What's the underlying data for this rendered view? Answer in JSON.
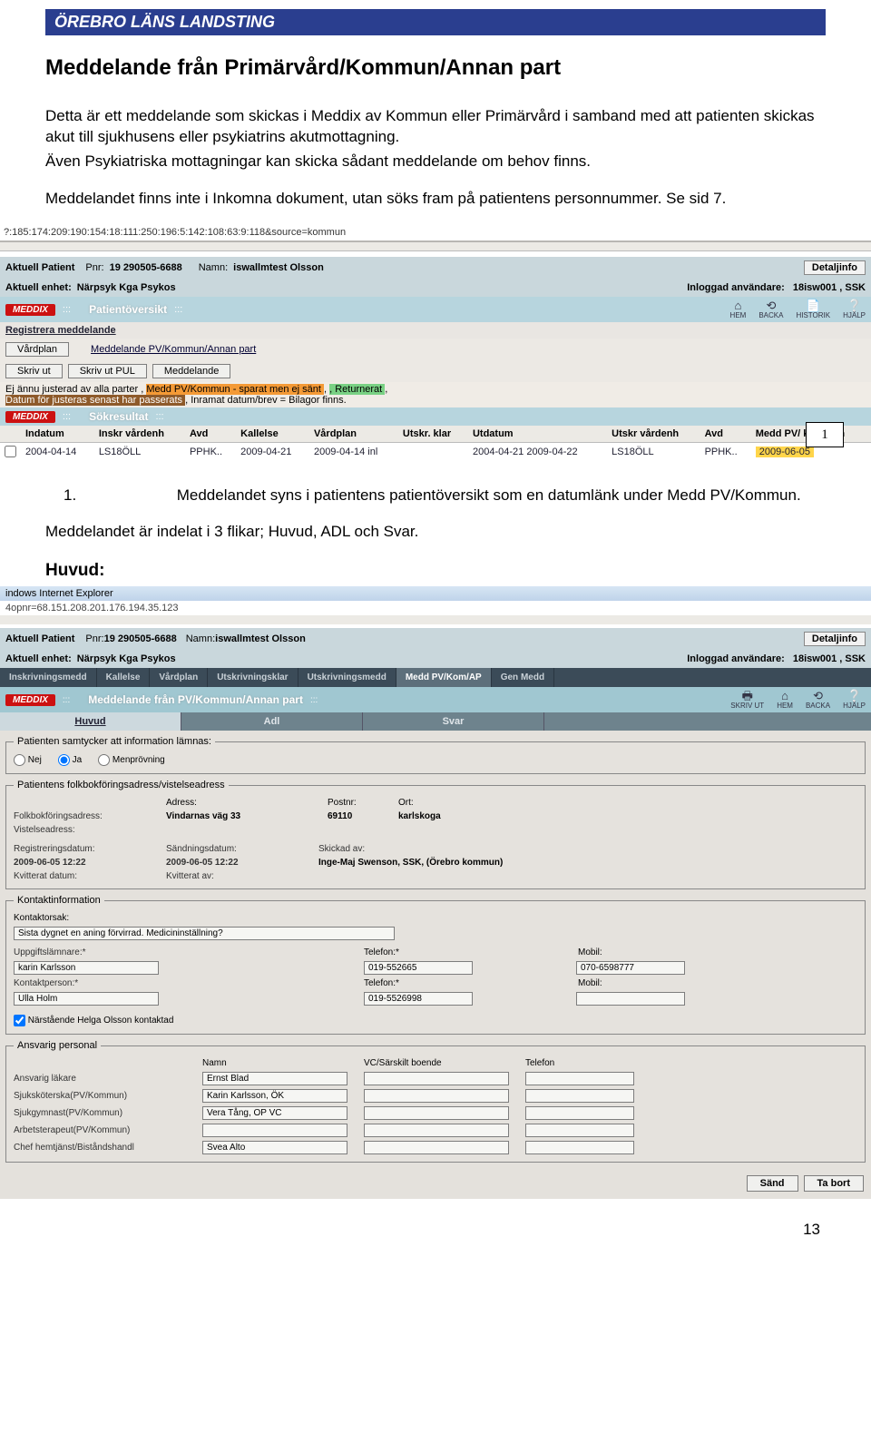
{
  "banner": "ÖREBRO LÄNS LANDSTING",
  "doc": {
    "title": "Meddelande från Primärvård/Kommun/Annan part",
    "para1": "Detta är ett meddelande som skickas i Meddix av Kommun eller Primärvård i samband med att patienten skickas akut till sjukhusens eller psykiatrins akutmottagning.",
    "para2": "Även Psykiatriska mottagningar kan skicka sådant meddelande om behov finns.",
    "para3": "Meddelandet finns inte i Inkomna dokument, utan söks fram på patientens personnummer. Se sid 7.",
    "list_num": "1.",
    "list_text": "Meddelandet syns i patientens patientöversikt som en datumlänk under Medd PV/Kommun.",
    "tabs_text": "Meddelandet är indelat i 3 flikar; Huvud, ADL och Svar.",
    "huvud_head": "Huvud:"
  },
  "shot1": {
    "url": "?:185:174:209:190:154:18:111:250:196:5:142:108:63:9:118&source=kommun",
    "patient_lbl": "Aktuell Patient",
    "pnr_lbl": "Pnr:",
    "pnr": "19 290505-6688",
    "namn_lbl": "Namn:",
    "namn": "iswallmtest Olsson",
    "detail": "Detaljinfo",
    "enhet_lbl": "Aktuell enhet:",
    "enhet": "Närpsyk Kga Psykos",
    "inlogg_lbl": "Inloggad användare:",
    "inlogg": "18isw001 , SSK",
    "overview": "Patientöversikt",
    "icons": {
      "hem": "HEM",
      "backa": "BACKA",
      "historik": "HISTORIK",
      "hjalp": "HJÄLP"
    },
    "reg_medd": "Registrera meddelande",
    "btns1": {
      "vardplan": "Vårdplan",
      "link_mpv": "Meddelande PV/Kommun/Annan part"
    },
    "btns2": {
      "skriv": "Skriv ut",
      "skriv_pul": "Skriv ut PUL",
      "medd": "Meddelande"
    },
    "legend": {
      "a": "Ej ännu justerad av alla parter ,",
      "b": " Medd PV/Kommun - sparat men ej sänt ",
      "c": ", Returnerat ",
      "d": "Datum för justeras senast har passerats ",
      "e": ", Inramat datum/brev = Bilagor finns."
    },
    "sokresultat": "Sökresultat",
    "cols": [
      "",
      "Indatum",
      "Inskr vårdenh",
      "Avd",
      "Kallelse",
      "Vårdplan",
      "Utskr. klar",
      "Utdatum",
      "Utskr vårdenh",
      "Avd",
      "Medd PV/ kommun"
    ],
    "row": [
      "",
      "2004-04-14",
      "LS18ÖLL",
      "PPHK..",
      "2009-04-21",
      "2009-04-14 inl",
      "",
      "2004-04-21",
      "2009-04-22",
      "LS18ÖLL",
      "PPHK..",
      "2009-06-05"
    ]
  },
  "callout": "1",
  "shot2": {
    "win": "indows Internet Explorer",
    "ip": "4opnr=68.151.208.201.176.194.35.123",
    "patient_lbl": "Aktuell Patient",
    "pnr_lbl": "Pnr:",
    "pnr": "19 290505-6688",
    "namn_lbl": "Namn:",
    "namn": "iswallmtest Olsson",
    "detail": "Detaljinfo",
    "enhet_lbl": "Aktuell enhet:",
    "enhet": "Närpsyk Kga Psykos",
    "inlogg_lbl": "Inloggad användare:",
    "inlogg": "18isw001 , SSK",
    "tabs": [
      "Inskrivningsmedd",
      "Kallelse",
      "Vårdplan",
      "Utskrivningsklar",
      "Utskrivningsmedd",
      "Medd PV/Kom/AP",
      "Gen Medd"
    ],
    "active_tab": 5,
    "page_title": "Meddelande från PV/Kommun/Annan part",
    "icons": {
      "skriv": "SKRIV UT",
      "hem": "HEM",
      "backa": "BACKA",
      "hjalp": "HJÄLP"
    },
    "subtabs": [
      "Huvud",
      "Adl",
      "Svar"
    ],
    "consent_legend": "Patienten samtycker att information lämnas:",
    "nej": "Nej",
    "ja": "Ja",
    "men": "Menprövning",
    "addr_legend": "Patientens folkbokföringsadress/vistelseadress",
    "addr_hdr": {
      "c1": "Adress:",
      "c2": "Postnr:",
      "c3": "Ort:"
    },
    "folk_lbl": "Folkbokföringsadress:",
    "folk_addr": "Vindarnas väg 33",
    "folk_post": "69110",
    "folk_ort": "karlskoga",
    "vist_lbl": "Vistelseadress:",
    "regdat_lbl": "Registreringsdatum:",
    "regdat": "2009-06-05 12:22",
    "sanddat_lbl": "Sändningsdatum:",
    "sanddat": "2009-06-05 12:22",
    "skick_lbl": "Skickad av:",
    "skick": "Inge-Maj Swenson, SSK, (Örebro kommun)",
    "kvitt_lbl": "Kvitterat datum:",
    "kvittav_lbl": "Kvitterat av:",
    "kontakt_legend": "Kontaktinformation",
    "kontorsak_lbl": "Kontaktorsak:",
    "kontorsak": "Sista dygnet en aning förvirrad. Medicininställning?",
    "upplamn_lbl": "Uppgiftslämnare:*",
    "upplamn": "karin Karlsson",
    "tel_lbl": "Telefon:*",
    "tel1": "019-552665",
    "mob_lbl": "Mobil:",
    "mob1": "070-6598777",
    "kontp_lbl": "Kontaktperson:*",
    "kontp": "Ulla Holm",
    "tel2": "019-5526998",
    "nar_lbl": "Närstående Helga Olsson kontaktad",
    "ansv_legend": "Ansvarig personal",
    "ansv_hdr": {
      "n": "Namn",
      "v": "VC/Särskilt boende",
      "t": "Telefon"
    },
    "rows": [
      {
        "l": "Ansvarig läkare",
        "n": "Ernst Blad"
      },
      {
        "l": "Sjuksköterska(PV/Kommun)",
        "n": "Karin Karlsson, ÖK"
      },
      {
        "l": "Sjukgymnast(PV/Kommun)",
        "n": "Vera Tång, OP VC"
      },
      {
        "l": "Arbetsterapeut(PV/Kommun)",
        "n": ""
      },
      {
        "l": "Chef hemtjänst/Biståndshandl",
        "n": "Svea Alto"
      }
    ],
    "btn_send": "Sänd",
    "btn_del": "Ta bort"
  },
  "page_num": "13"
}
